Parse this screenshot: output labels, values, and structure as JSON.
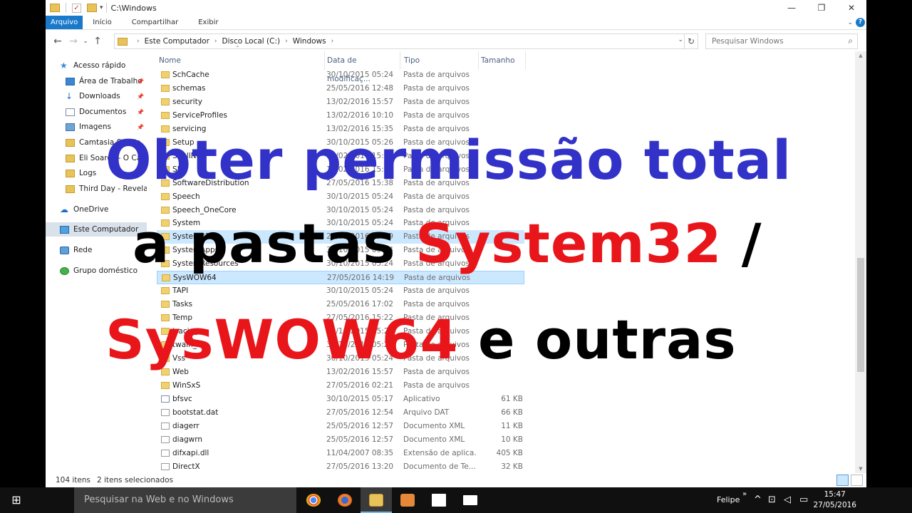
{
  "window": {
    "title": "C:\\Windows",
    "controls": [
      "—",
      "❐",
      "✕"
    ]
  },
  "ribbon": {
    "tabs": [
      "Arquivo",
      "Início",
      "Compartilhar",
      "Exibir"
    ],
    "help": "?"
  },
  "address": {
    "crumbs": [
      "Este Computador",
      "Disco Local (C:)",
      "Windows"
    ],
    "search_placeholder": "Pesquisar Windows"
  },
  "nav": {
    "items": [
      {
        "label": "Acesso rápido",
        "icon": "star-icon",
        "pinned": false
      },
      {
        "label": "Área de Trabalho",
        "icon": "desktop-icon",
        "pinned": true
      },
      {
        "label": "Downloads",
        "icon": "download-icon",
        "pinned": true
      },
      {
        "label": "Documentos",
        "icon": "document-icon",
        "pinned": true
      },
      {
        "label": "Imagens",
        "icon": "pictures-icon",
        "pinned": true
      },
      {
        "label": "Camtasia Studio",
        "icon": "folder-icon",
        "pinned": false
      },
      {
        "label": "Eli Soares - O Casa D",
        "icon": "folder-icon",
        "pinned": false
      },
      {
        "label": "Logs",
        "icon": "folder-icon",
        "pinned": false
      },
      {
        "label": "Third Day - Revelatio",
        "icon": "folder-icon",
        "pinned": false
      },
      {
        "label": "OneDrive",
        "icon": "onedrive-icon",
        "pinned": false
      },
      {
        "label": "Este Computador",
        "icon": "computer-icon",
        "pinned": false
      },
      {
        "label": "Rede",
        "icon": "network-icon",
        "pinned": false
      },
      {
        "label": "Grupo doméstico",
        "icon": "homegroup-icon",
        "pinned": false
      }
    ]
  },
  "columns": [
    "Nome",
    "Data de modificaç...",
    "Tipo",
    "Tamanho"
  ],
  "files": [
    {
      "name": "SchCache",
      "date": "30/10/2015 05:24",
      "type": "Pasta de arquivos",
      "size": "",
      "kind": "folder"
    },
    {
      "name": "schemas",
      "date": "25/05/2016 12:48",
      "type": "Pasta de arquivos",
      "size": "",
      "kind": "folder"
    },
    {
      "name": "security",
      "date": "13/02/2016 15:57",
      "type": "Pasta de arquivos",
      "size": "",
      "kind": "folder"
    },
    {
      "name": "ServiceProfiles",
      "date": "13/02/2016 10:10",
      "type": "Pasta de arquivos",
      "size": "",
      "kind": "folder"
    },
    {
      "name": "servicing",
      "date": "13/02/2016 15:35",
      "type": "Pasta de arquivos",
      "size": "",
      "kind": "folder"
    },
    {
      "name": "Setup",
      "date": "30/10/2015 05:26",
      "type": "Pasta de arquivos",
      "size": "",
      "kind": "folder"
    },
    {
      "name": "ShellNew",
      "date": "13/02/2016 15:57",
      "type": "Pasta de arquivos",
      "size": "",
      "kind": "folder"
    },
    {
      "name": "SKB",
      "date": "13/02/2016 15:39",
      "type": "Pasta de arquivos",
      "size": "",
      "kind": "folder"
    },
    {
      "name": "SoftwareDistribution",
      "date": "27/05/2016 15:38",
      "type": "Pasta de arquivos",
      "size": "",
      "kind": "folder"
    },
    {
      "name": "Speech",
      "date": "30/10/2015 05:24",
      "type": "Pasta de arquivos",
      "size": "",
      "kind": "folder"
    },
    {
      "name": "Speech_OneCore",
      "date": "30/10/2015 05:24",
      "type": "Pasta de arquivos",
      "size": "",
      "kind": "folder"
    },
    {
      "name": "System",
      "date": "30/10/2015 05:24",
      "type": "Pasta de arquivos",
      "size": "",
      "kind": "folder"
    },
    {
      "name": "System32",
      "date": "27/05/2016 13:49",
      "type": "Pasta de arquivos",
      "size": "",
      "kind": "folder",
      "sel": "sel"
    },
    {
      "name": "SystemApps",
      "date": "30/10/2015 05:24",
      "type": "Pasta de arquivos",
      "size": "",
      "kind": "folder"
    },
    {
      "name": "SystemResources",
      "date": "30/10/2015 05:24",
      "type": "Pasta de arquivos",
      "size": "",
      "kind": "folder"
    },
    {
      "name": "SysWOW64",
      "date": "27/05/2016 14:19",
      "type": "Pasta de arquivos",
      "size": "",
      "kind": "folder",
      "sel": "selb"
    },
    {
      "name": "TAPI",
      "date": "30/10/2015 05:24",
      "type": "Pasta de arquivos",
      "size": "",
      "kind": "folder"
    },
    {
      "name": "Tasks",
      "date": "25/05/2016 17:02",
      "type": "Pasta de arquivos",
      "size": "",
      "kind": "folder"
    },
    {
      "name": "Temp",
      "date": "27/05/2016 15:22",
      "type": "Pasta de arquivos",
      "size": "",
      "kind": "folder"
    },
    {
      "name": "tracing",
      "date": "30/10/2015 05:24",
      "type": "Pasta de arquivos",
      "size": "",
      "kind": "folder"
    },
    {
      "name": "twain_32",
      "date": "30/10/2015 05:24",
      "type": "Pasta de arquivos",
      "size": "",
      "kind": "folder"
    },
    {
      "name": "Vss",
      "date": "30/10/2015 05:24",
      "type": "Pasta de arquivos",
      "size": "",
      "kind": "folder"
    },
    {
      "name": "Web",
      "date": "13/02/2016 15:57",
      "type": "Pasta de arquivos",
      "size": "",
      "kind": "folder"
    },
    {
      "name": "WinSxS",
      "date": "27/05/2016 02:21",
      "type": "Pasta de arquivos",
      "size": "",
      "kind": "folder"
    },
    {
      "name": "bfsvc",
      "date": "30/10/2015 05:17",
      "type": "Aplicativo",
      "size": "61 KB",
      "kind": "app"
    },
    {
      "name": "bootstat.dat",
      "date": "27/05/2016 12:54",
      "type": "Arquivo DAT",
      "size": "66 KB",
      "kind": "file"
    },
    {
      "name": "diagerr",
      "date": "25/05/2016 12:57",
      "type": "Documento XML",
      "size": "11 KB",
      "kind": "file"
    },
    {
      "name": "diagwrn",
      "date": "25/05/2016 12:57",
      "type": "Documento XML",
      "size": "10 KB",
      "kind": "file"
    },
    {
      "name": "difxapi.dll",
      "date": "11/04/2007 08:35",
      "type": "Extensão de aplica...",
      "size": "405 KB",
      "kind": "file"
    },
    {
      "name": "DirectX",
      "date": "27/05/2016 13:20",
      "type": "Documento de Te...",
      "size": "32 KB",
      "kind": "file"
    }
  ],
  "status": {
    "count": "104 itens",
    "selected": "2 itens selecionados"
  },
  "overlay": {
    "line1": "Obter permissão total",
    "line2_a": "a pastas ",
    "line2_b": "System32",
    "line2_c": " /",
    "line3_a": "SysWOW64",
    "line3_b": " e outras"
  },
  "taskbar": {
    "search_placeholder": "Pesquisar na Web e no Windows",
    "user": "Felipe",
    "time": "15:47",
    "date": "27/05/2016"
  },
  "colors": {
    "accent": "#1979ca",
    "headline_blue": "#3232c8",
    "headline_red": "#e8151a",
    "selection": "#cce8ff"
  }
}
